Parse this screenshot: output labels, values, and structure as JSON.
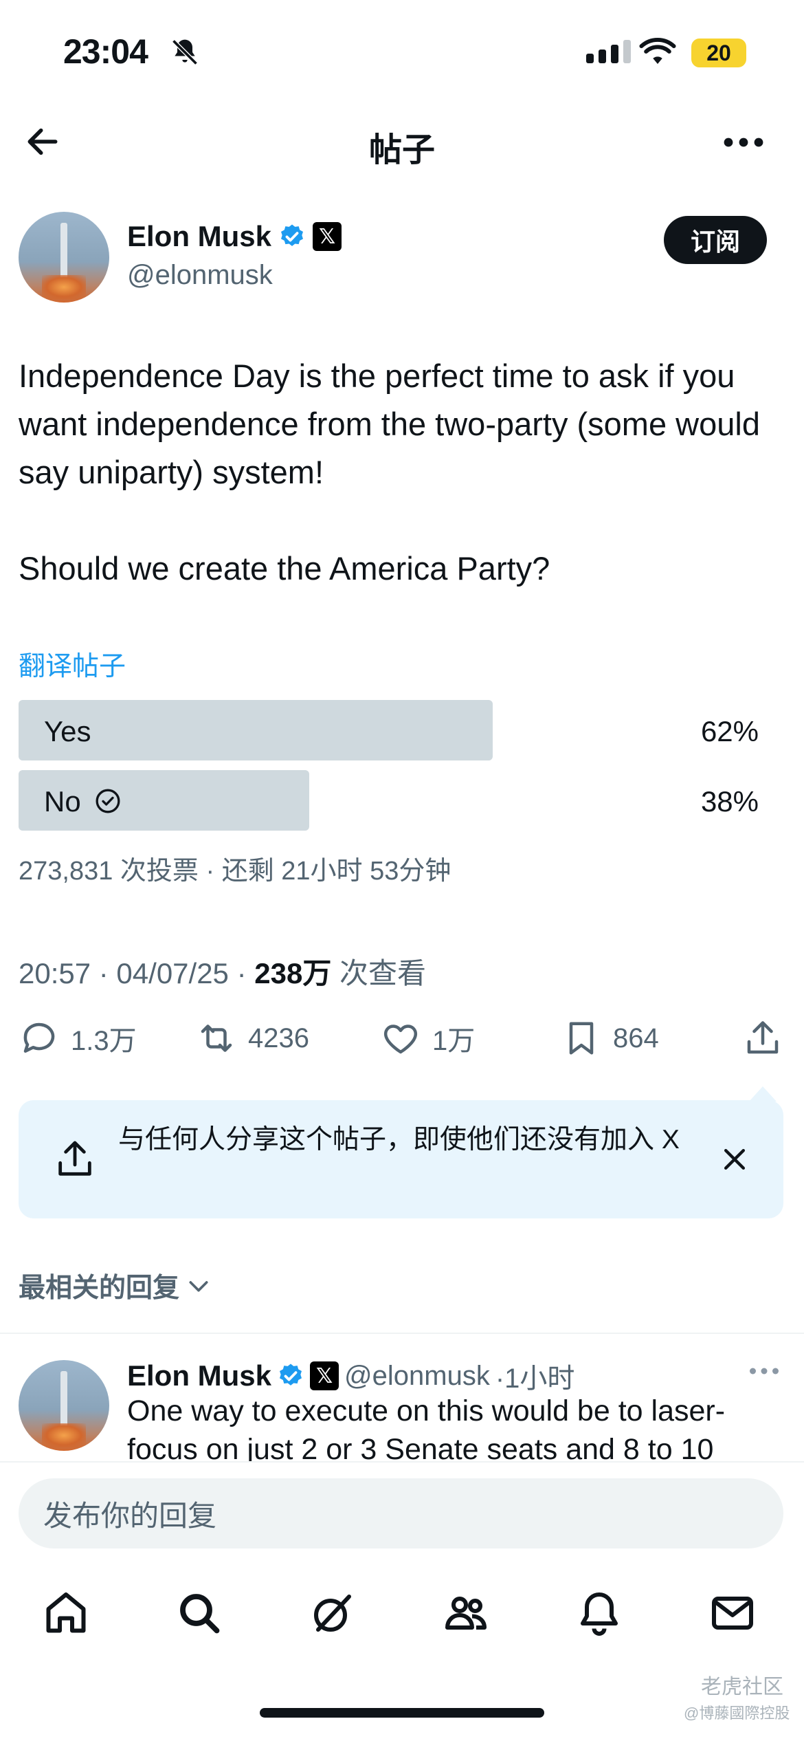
{
  "status_bar": {
    "time": "23:04",
    "battery": "20"
  },
  "nav": {
    "title": "帖子"
  },
  "author": {
    "name": "Elon Musk",
    "handle": "@elonmusk",
    "subscribe_label": "订阅"
  },
  "post": {
    "text": "Independence Day is the perfect time to ask if you want independence from the two-party (some would say uniparty) system!\n\nShould we create the America Party?",
    "translate_label": "翻译帖子"
  },
  "poll": {
    "options": [
      {
        "label": "Yes",
        "percent": "62%",
        "fraction": 0.62
      },
      {
        "label": "No",
        "percent": "38%",
        "fraction": 0.38
      }
    ],
    "meta": "273,831 次投票 · 还剩 21小时 53分钟"
  },
  "post_meta": {
    "time_date": "20:57 · 04/07/25 · ",
    "views": "238万",
    "views_suffix": " 次查看"
  },
  "actions": {
    "replies": "1.3万",
    "reposts": "4236",
    "likes": "1万",
    "bookmarks": "864"
  },
  "share_prompt": {
    "text": "与任何人分享这个帖子，即使他们还没有加入 X"
  },
  "replies_section": {
    "sort_label": "最相关的回复"
  },
  "reply": {
    "name": "Elon Musk",
    "handle": "@elonmusk",
    "time": "·1小时",
    "text_line1": "One way to execute on this would be to laser-",
    "text_line2": "focus on just 2 or 3 Senate seats and 8 to 10"
  },
  "composer": {
    "placeholder": "发布你的回复"
  },
  "tabbar": {
    "items": [
      "home-icon",
      "search-icon",
      "grok-icon",
      "communities-icon",
      "notifications-icon",
      "messages-icon"
    ]
  },
  "watermark": {
    "line1": "老虎社区",
    "line2": "@博藤國際控股"
  },
  "colors": {
    "accent": "#1d9bf0",
    "text": "#0f1419",
    "secondary": "#536471",
    "poll_bar": "#cfd9de",
    "share_bg": "#e8f5fd"
  }
}
